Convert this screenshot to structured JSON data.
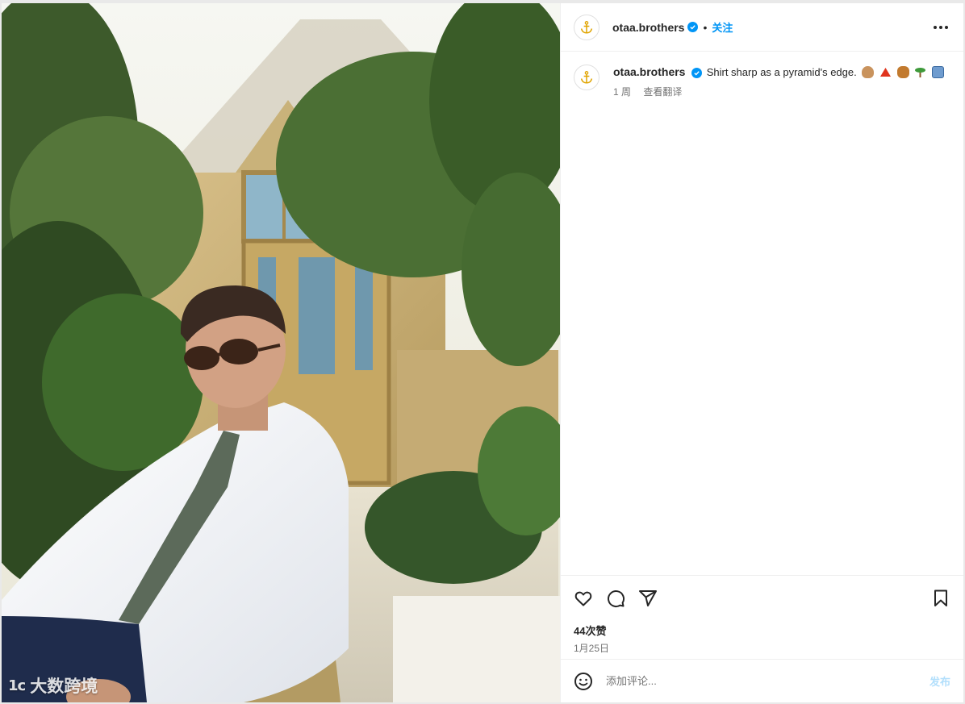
{
  "colors": {
    "link_blue": "#0095f6",
    "post_disabled": "#b2dffc",
    "text": "#262626",
    "muted": "#737373"
  },
  "post": {
    "username": "otaa.brothers",
    "follow_label": "关注",
    "separator": "•",
    "caption": "Shirt sharp as a pyramid's edge.",
    "caption_emojis": [
      "hand-emoji",
      "red-triangle-emoji",
      "camel-emoji",
      "palm-tree-emoji",
      "building-emoji"
    ],
    "time_ago": "1 周",
    "translate_label": "查看翻译",
    "likes": "44次赞",
    "date": "1月25日"
  },
  "icons": {
    "avatar": "anchor-icon",
    "verified": "verified-badge-icon",
    "more": "more-horizontal-icon",
    "like": "heart-icon",
    "comment": "comment-bubble-icon",
    "share": "send-icon",
    "save": "bookmark-icon",
    "emoji": "smile-icon"
  },
  "comment_box": {
    "placeholder": "添加评论...",
    "post_label": "发布"
  },
  "watermark": {
    "logo": "1c",
    "text": "大数跨境"
  }
}
